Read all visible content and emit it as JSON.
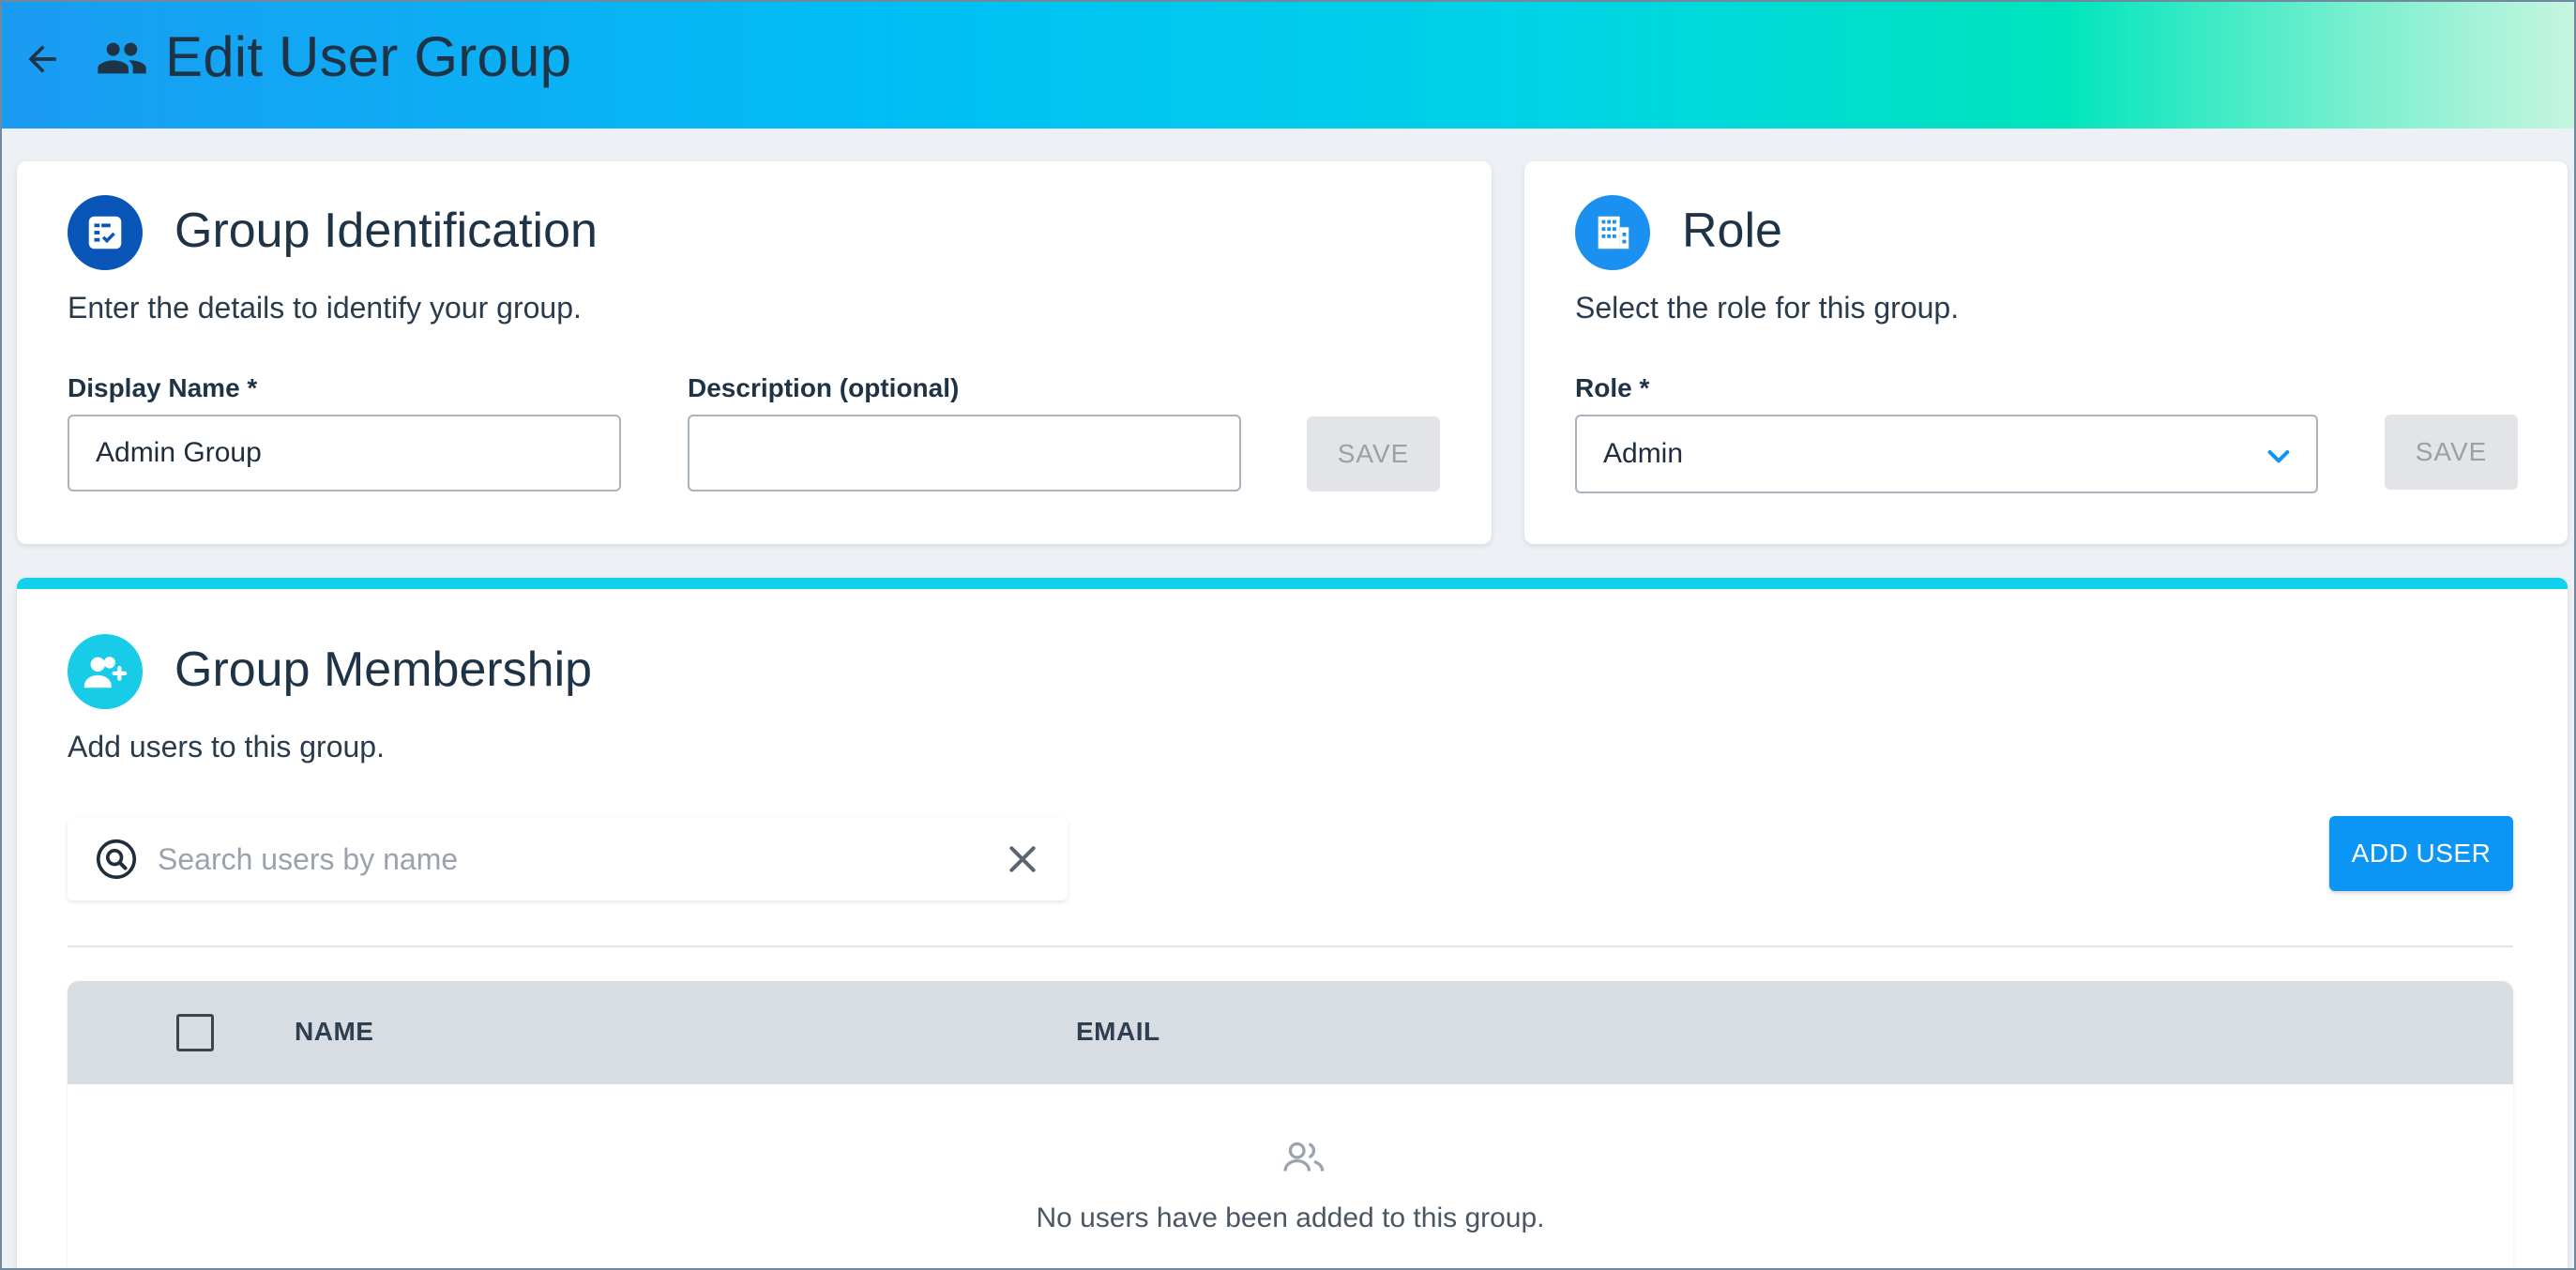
{
  "header": {
    "title": "Edit User Group",
    "back_icon": "arrow-left-icon",
    "title_icon": "people-icon"
  },
  "identification": {
    "title": "Group Identification",
    "subtitle": "Enter the details to identify your group.",
    "icon": "checklist-icon",
    "display_name_label": "Display Name *",
    "display_name_value": "Admin Group",
    "description_label": "Description (optional)",
    "description_value": "",
    "save_label": "SAVE"
  },
  "role": {
    "title": "Role",
    "subtitle": "Select the role for this group.",
    "icon": "building-icon",
    "role_label": "Role *",
    "role_value": "Admin",
    "save_label": "SAVE"
  },
  "membership": {
    "title": "Group Membership",
    "subtitle": "Add users to this group.",
    "icon": "add-user-icon",
    "search_placeholder": "Search users by name",
    "add_user_label": "ADD USER",
    "columns": [
      "NAME",
      "EMAIL"
    ],
    "empty_message": "No users have been added to this group."
  },
  "colors": {
    "accent": "#0b96f6",
    "membership_accent": "#11d2ea",
    "ident_icon_bg": "#0a56b8",
    "role_icon_bg": "#1a90f0",
    "member_icon_bg": "#18cbe6"
  }
}
